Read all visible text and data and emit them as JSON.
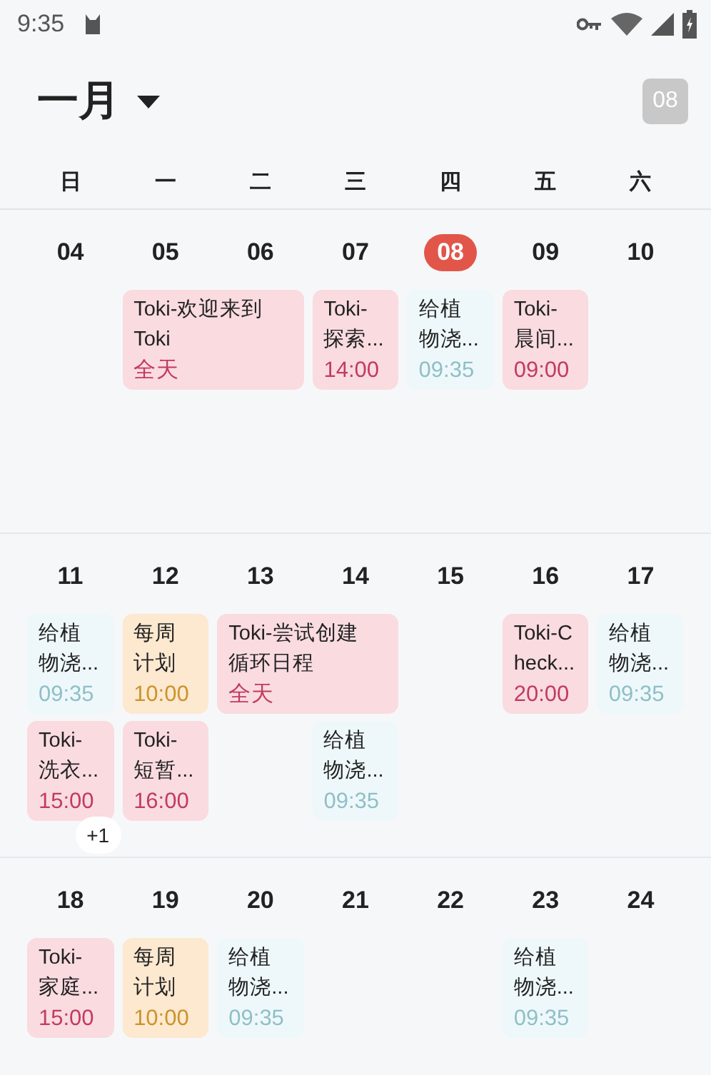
{
  "status_bar": {
    "time": "9:35"
  },
  "header": {
    "month": "一月",
    "today_badge": "08"
  },
  "weekdays": [
    "日",
    "一",
    "二",
    "三",
    "四",
    "五",
    "六"
  ],
  "weeks": [
    {
      "days": [
        {
          "date": "04",
          "today": false
        },
        {
          "date": "05",
          "today": false,
          "events": [
            {
              "title": "Toki-欢迎来到Toki",
              "time": "全天",
              "color": "#f9dbe0",
              "kind": "twoday"
            }
          ]
        },
        {
          "date": "06",
          "today": false
        },
        {
          "date": "07",
          "today": false,
          "events": [
            {
              "title": "Toki-探索...",
              "time": "14:00",
              "color": "#f9dbe0",
              "kind": "single"
            }
          ]
        },
        {
          "date": "08",
          "today": true,
          "events": [
            {
              "title": "给植物浇...",
              "time": "09:35",
              "color": "#eef8fb",
              "kind": "single"
            }
          ]
        },
        {
          "date": "09",
          "today": false,
          "events": [
            {
              "title": "Toki-晨间...",
              "time": "09:00",
              "color": "#f9dbe0",
              "kind": "single"
            }
          ]
        },
        {
          "date": "10",
          "today": false
        }
      ]
    },
    {
      "days": [
        {
          "date": "11",
          "today": false,
          "more": "+1",
          "events": [
            {
              "title": "给植物浇...",
              "time": "09:35",
              "color": "#eef8fb",
              "kind": "single"
            },
            {
              "title": "Toki-洗衣...",
              "time": "15:00",
              "color": "#f9dbe0",
              "kind": "single"
            }
          ]
        },
        {
          "date": "12",
          "today": false,
          "events": [
            {
              "title": "每周计划",
              "time": "10:00",
              "color": "#fde8d0",
              "kind": "single"
            },
            {
              "title": "Toki-短暂...",
              "time": "16:00",
              "color": "#f9dbe0",
              "kind": "single"
            }
          ]
        },
        {
          "date": "13",
          "today": false,
          "events": [
            {
              "title": "Toki-尝试创建循环日程",
              "time": "全天",
              "color": "#f9dbe0",
              "kind": "twoday"
            }
          ]
        },
        {
          "date": "14",
          "today": false,
          "events": [
            {
              "title": "给植物浇...",
              "time": "09:35",
              "color": "#eef8fb",
              "kind": "single"
            }
          ]
        },
        {
          "date": "15",
          "today": false
        },
        {
          "date": "16",
          "today": false,
          "events": [
            {
              "title": "Toki-Check...",
              "time": "20:00",
              "color": "#f9dbe0",
              "kind": "single"
            }
          ]
        },
        {
          "date": "17",
          "today": false,
          "events": [
            {
              "title": "给植物浇...",
              "time": "09:35",
              "color": "#eef8fb",
              "kind": "single"
            }
          ]
        }
      ]
    },
    {
      "days": [
        {
          "date": "18",
          "today": false,
          "events": [
            {
              "title": "Toki-家庭...",
              "time": "15:00",
              "color": "#f9dbe0",
              "kind": "single"
            }
          ]
        },
        {
          "date": "19",
          "today": false,
          "events": [
            {
              "title": "每周计划",
              "time": "10:00",
              "color": "#fde8d0",
              "kind": "single"
            }
          ]
        },
        {
          "date": "20",
          "today": false,
          "events": [
            {
              "title": "给植物浇...",
              "time": "09:35",
              "color": "#eef8fb",
              "kind": "single"
            }
          ]
        },
        {
          "date": "21",
          "today": false
        },
        {
          "date": "22",
          "today": false
        },
        {
          "date": "23",
          "today": false,
          "events": [
            {
              "title": "给植物浇...",
              "time": "09:35",
              "color": "#eef8fb",
              "kind": "single"
            }
          ]
        },
        {
          "date": "24",
          "today": false
        }
      ]
    }
  ]
}
